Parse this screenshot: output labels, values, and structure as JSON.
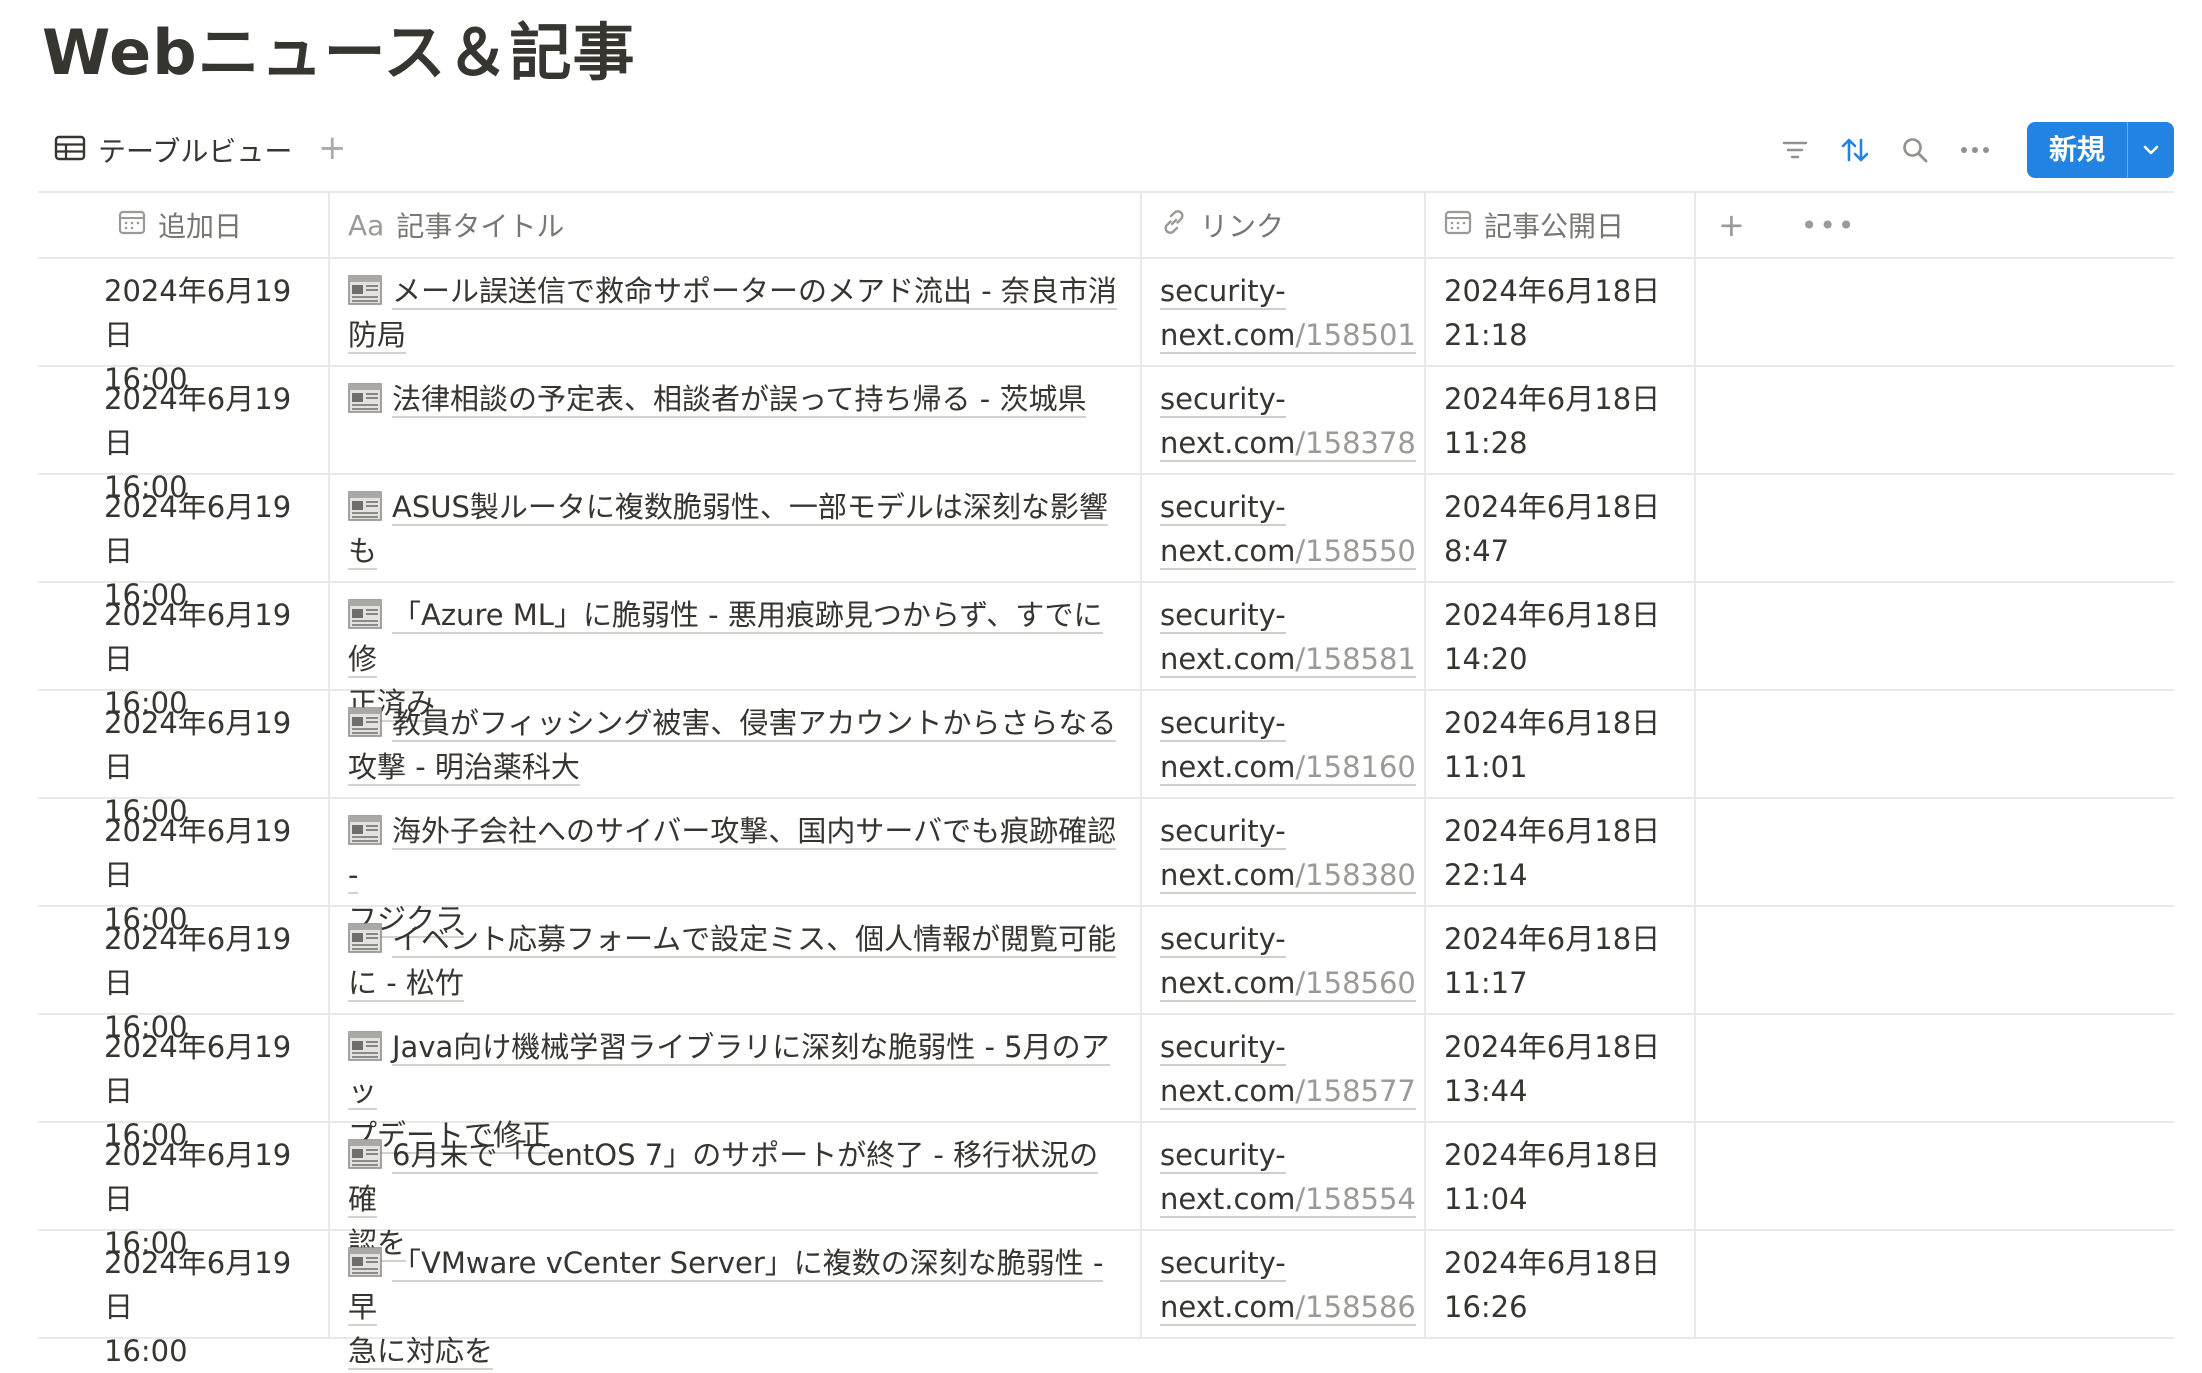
{
  "page": {
    "title": "Webニュース＆記事"
  },
  "toolbar": {
    "view_label": "テーブルビュー",
    "add_view": "+",
    "new_label": "新規",
    "accent_color": "#2383e2"
  },
  "table": {
    "columns": [
      {
        "label": "追加日",
        "icon": "calendar-icon"
      },
      {
        "label": "記事タイトル",
        "icon": "text-aa-icon",
        "icon_text": "Aa"
      },
      {
        "label": "リンク",
        "icon": "link-icon"
      },
      {
        "label": "記事公開日",
        "icon": "calendar-icon"
      }
    ],
    "add_column": "+",
    "more": "•••",
    "rows": [
      {
        "added_date": "2024年6月19日",
        "added_time": "16:00",
        "title_l1": "メール誤送信で救命サポーターのメアド流出 - 奈良市消",
        "title_l2": "防局",
        "link_host": "security-",
        "link_host2": "next.com",
        "link_path": "/158501",
        "pub_date": "2024年6月18日",
        "pub_time": "21:18"
      },
      {
        "added_date": "2024年6月19日",
        "added_time": "16:00",
        "title_l1": "法律相談の予定表、相談者が誤って持ち帰る - 茨城県",
        "title_l2": "",
        "link_host": "security-",
        "link_host2": "next.com",
        "link_path": "/158378",
        "pub_date": "2024年6月18日",
        "pub_time": "11:28"
      },
      {
        "added_date": "2024年6月19日",
        "added_time": "16:00",
        "title_l1": "ASUS製ルータに複数脆弱性、一部モデルは深刻な影響",
        "title_l2": "も",
        "link_host": "security-",
        "link_host2": "next.com",
        "link_path": "/158550",
        "pub_date": "2024年6月18日",
        "pub_time": "8:47"
      },
      {
        "added_date": "2024年6月19日",
        "added_time": "16:00",
        "title_l1": "「Azure ML」に脆弱性 - 悪用痕跡見つからず、すでに修",
        "title_l2": "正済み",
        "link_host": "security-",
        "link_host2": "next.com",
        "link_path": "/158581",
        "pub_date": "2024年6月18日",
        "pub_time": "14:20"
      },
      {
        "added_date": "2024年6月19日",
        "added_time": "16:00",
        "title_l1": "教員がフィッシング被害、侵害アカウントからさらなる",
        "title_l2": "攻撃 - 明治薬科大",
        "link_host": "security-",
        "link_host2": "next.com",
        "link_path": "/158160",
        "pub_date": "2024年6月18日",
        "pub_time": "11:01"
      },
      {
        "added_date": "2024年6月19日",
        "added_time": "16:00",
        "title_l1": "海外子会社へのサイバー攻撃、国内サーバでも痕跡確認 -",
        "title_l2": "フジクラ",
        "link_host": "security-",
        "link_host2": "next.com",
        "link_path": "/158380",
        "pub_date": "2024年6月18日",
        "pub_time": "22:14"
      },
      {
        "added_date": "2024年6月19日",
        "added_time": "16:00",
        "title_l1": "イベント応募フォームで設定ミス、個人情報が閲覧可能",
        "title_l2": "に - 松竹",
        "link_host": "security-",
        "link_host2": "next.com",
        "link_path": "/158560",
        "pub_date": "2024年6月18日",
        "pub_time": "11:17"
      },
      {
        "added_date": "2024年6月19日",
        "added_time": "16:00",
        "title_l1": "Java向け機械学習ライブラリに深刻な脆弱性 - 5月のアッ",
        "title_l2": "プデートで修正",
        "link_host": "security-",
        "link_host2": "next.com",
        "link_path": "/158577",
        "pub_date": "2024年6月18日",
        "pub_time": "13:44"
      },
      {
        "added_date": "2024年6月19日",
        "added_time": "16:00",
        "title_l1": "6月末で「CentOS 7」のサポートが終了 - 移行状況の確",
        "title_l2": "認を",
        "link_host": "security-",
        "link_host2": "next.com",
        "link_path": "/158554",
        "pub_date": "2024年6月18日",
        "pub_time": "11:04"
      },
      {
        "added_date": "2024年6月19日",
        "added_time": "16:00",
        "title_l1": "「VMware vCenter Server」に複数の深刻な脆弱性 - 早",
        "title_l2": "急に対応を",
        "link_host": "security-",
        "link_host2": "next.com",
        "link_path": "/158586",
        "pub_date": "2024年6月18日",
        "pub_time": "16:26"
      }
    ]
  }
}
